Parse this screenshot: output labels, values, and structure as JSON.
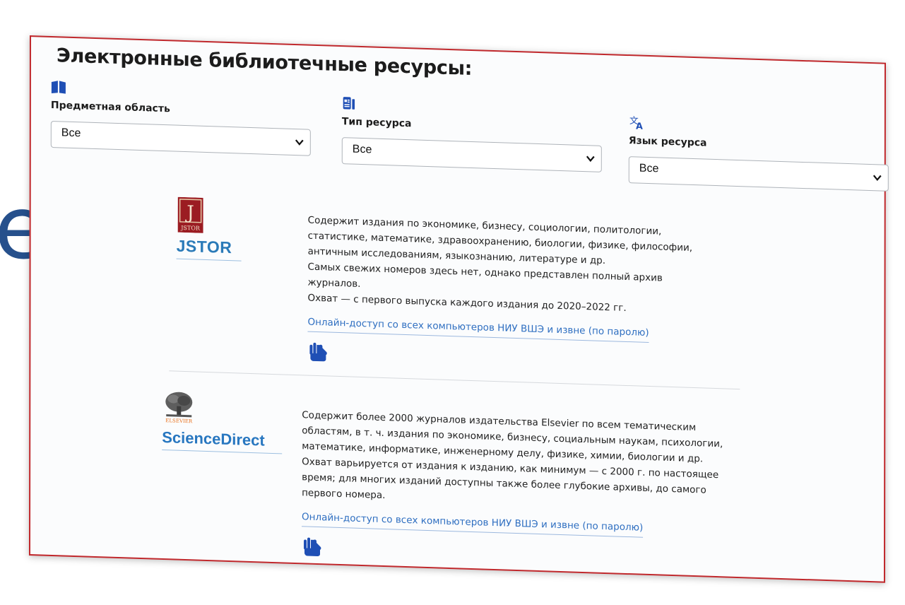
{
  "background_fragment": "е",
  "section": {
    "title": "Электронные библиотечные ресурсы:"
  },
  "filters": [
    {
      "label": "Предметная область",
      "selected": "Все",
      "icon": "book-icon"
    },
    {
      "label": "Тип ресурса",
      "selected": "Все",
      "icon": "document-list-icon"
    },
    {
      "label": "Язык ресурса",
      "selected": "Все",
      "icon": "translate-icon"
    }
  ],
  "resources": [
    {
      "logo_name": "JSTOR",
      "logo_emblem": "JSTOR",
      "description": [
        "Содержит издания по экономике, бизнесу, социологии, политологии, статистике, математике, здравоохранению, биологии, физике, философии, античным исследованиям, языкознанию, литературе и др.",
        "Самых свежих номеров здесь нет, однако представлен полный архив журналов.",
        "Охват — с первого выпуска каждого издания до 2020–2022 гг."
      ],
      "access_link": "Онлайн-доступ со всех компьютеров НИУ ВШЭ и извне (по паролю)",
      "access_icon": "hand-pointer-icon"
    },
    {
      "logo_name": "ScienceDirect",
      "logo_emblem": "ELSEVIER",
      "description": [
        "Содержит более 2000 журналов издательства Elsevier по всем тематическим областям, в т. ч. издания по экономике, бизнесу, социальным наукам, психологии, математике, информатике, инженерному делу, физике, химии, биологии и др. Охват варьируется от издания к изданию, как минимум — с 2000 г. по настоящее время; для многих изданий доступны также более глубокие архивы, до самого первого номера."
      ],
      "access_link": "Онлайн-доступ со всех компьютеров НИУ ВШЭ и извне (по паролю)",
      "access_icon": "hand-pointer-icon"
    }
  ],
  "colors": {
    "frame_border": "#c0282c",
    "link": "#2f6fc1",
    "icon_blue": "#1f4fb5",
    "jstor_red": "#9b1c22",
    "jstor_blue": "#2a7ab8",
    "elsevier_orange": "#e9711c"
  }
}
